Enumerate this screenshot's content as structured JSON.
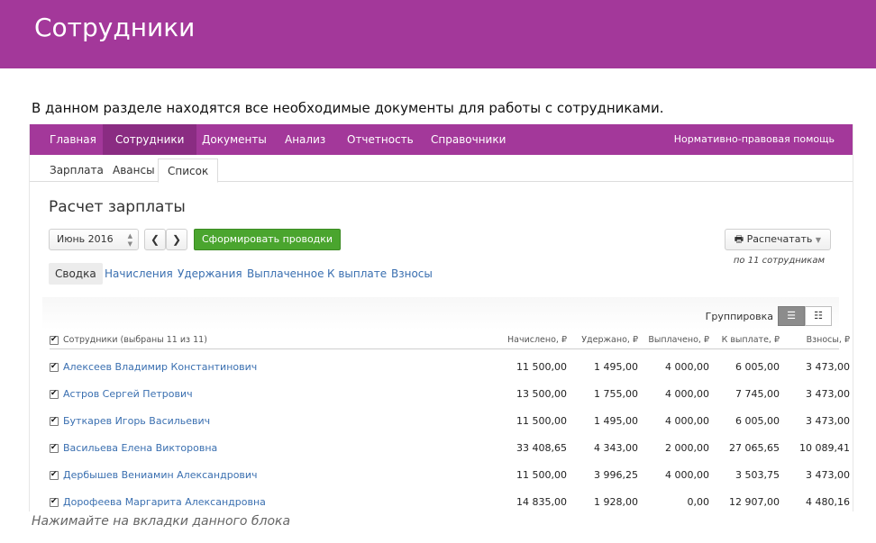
{
  "banner": {
    "title": "Сотрудники"
  },
  "intro": "В данном разделе находятся все необходимые документы для работы с сотрудниками.",
  "nav": {
    "items": [
      "Главная",
      "Сотрудники",
      "Документы",
      "Анализ",
      "Отчетность",
      "Справочники"
    ],
    "active": "Сотрудники",
    "help": "Нормативно-правовая помощь"
  },
  "subtabs": {
    "items": [
      "Зарплата",
      "Авансы",
      "Список"
    ],
    "active": "Список"
  },
  "page": {
    "title": "Расчет зарплаты",
    "period": "Июнь 2016",
    "prev": "❮",
    "next": "❯",
    "generate_button": "Сформировать проводки",
    "print_button": "Распечатать",
    "print_note": "по 11 сотрудникам"
  },
  "tabs": {
    "items": [
      "Сводка",
      "Начисления",
      "Удержания",
      "Выплаченное",
      "К выплате",
      "Взносы"
    ],
    "active": "Сводка"
  },
  "grouping": {
    "label": "Группировка"
  },
  "table": {
    "columns": [
      "Сотрудники (выбраны 11 из 11)",
      "Начислено, ₽",
      "Удержано, ₽",
      "Выплачено, ₽",
      "К выплате, ₽",
      "Взносы, ₽"
    ],
    "rows": [
      {
        "name": "Алексеев Владимир Константинович",
        "accrued": "11 500,00",
        "withheld": "1 495,00",
        "paid": "4 000,00",
        "to_pay": "6 005,00",
        "contrib": "3 473,00"
      },
      {
        "name": "Астров Сергей Петрович",
        "accrued": "13 500,00",
        "withheld": "1 755,00",
        "paid": "4 000,00",
        "to_pay": "7 745,00",
        "contrib": "3 473,00"
      },
      {
        "name": "Буткарев Игорь Васильевич",
        "accrued": "11 500,00",
        "withheld": "1 495,00",
        "paid": "4 000,00",
        "to_pay": "6 005,00",
        "contrib": "3 473,00"
      },
      {
        "name": "Васильева Елена Викторовна",
        "accrued": "33 408,65",
        "withheld": "4 343,00",
        "paid": "2 000,00",
        "to_pay": "27 065,65",
        "contrib": "10 089,41"
      },
      {
        "name": "Дербышев Вениамин Александрович",
        "accrued": "11 500,00",
        "withheld": "3 996,25",
        "paid": "4 000,00",
        "to_pay": "3 503,75",
        "contrib": "3 473,00"
      },
      {
        "name": "Дорофеева Маргарита Александровна",
        "accrued": "14 835,00",
        "withheld": "1 928,00",
        "paid": "0,00",
        "to_pay": "12 907,00",
        "contrib": "4 480,16"
      }
    ]
  },
  "hint": "Нажимайте на вкладки данного блока",
  "colors": {
    "brand": "#a3389a",
    "link": "#3a6fb0",
    "green": "#4aa52e"
  }
}
